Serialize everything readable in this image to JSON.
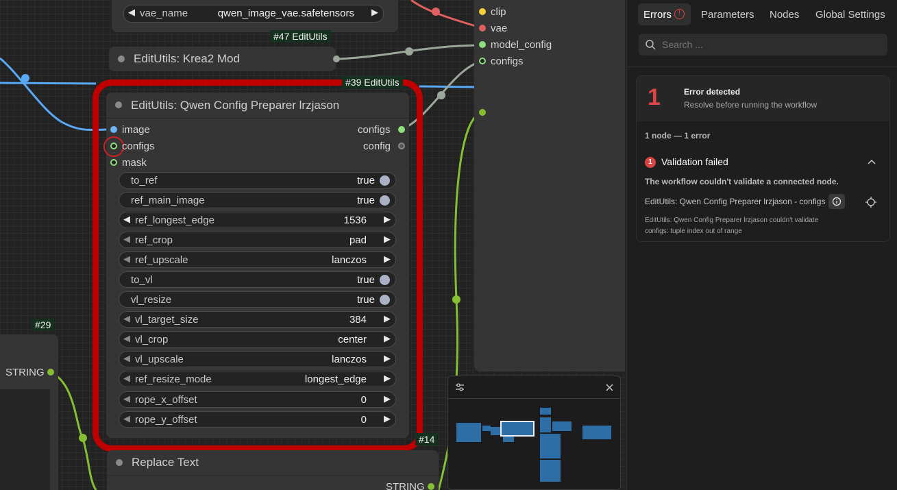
{
  "canvas": {
    "vae_loader": {
      "widget_label": "vae_name",
      "widget_value": "qwen_image_vae.safetensors"
    },
    "node_krea": {
      "badge": "#47 EditUtils",
      "title": "EditUtils: Krea2 Mod"
    },
    "loader_node": {
      "outputs": [
        "clip",
        "vae",
        "model_config",
        "configs"
      ]
    },
    "main_node": {
      "badge": "#39 EditUtils",
      "title": "EditUtils: Qwen Config Preparer lrzjason",
      "inputs": [
        "image",
        "configs",
        "mask"
      ],
      "outputs": [
        "configs",
        "config"
      ],
      "widgets": [
        {
          "label": "to_ref",
          "value": "true",
          "kind": "toggle"
        },
        {
          "label": "ref_main_image",
          "value": "true",
          "kind": "toggle"
        },
        {
          "label": "ref_longest_edge",
          "value": "1536",
          "kind": "number"
        },
        {
          "label": "ref_crop",
          "value": "pad",
          "kind": "combo"
        },
        {
          "label": "ref_upscale",
          "value": "lanczos",
          "kind": "combo"
        },
        {
          "label": "to_vl",
          "value": "true",
          "kind": "toggle"
        },
        {
          "label": "vl_resize",
          "value": "true",
          "kind": "toggle"
        },
        {
          "label": "vl_target_size",
          "value": "384",
          "kind": "number"
        },
        {
          "label": "vl_crop",
          "value": "center",
          "kind": "combo"
        },
        {
          "label": "vl_upscale",
          "value": "lanczos",
          "kind": "combo"
        },
        {
          "label": "ref_resize_mode",
          "value": "longest_edge",
          "kind": "combo"
        },
        {
          "label": "rope_x_offset",
          "value": "0",
          "kind": "number"
        },
        {
          "label": "rope_y_offset",
          "value": "0",
          "kind": "number"
        }
      ]
    },
    "node_29": {
      "badge": "#29",
      "output": "STRING"
    },
    "node_14": {
      "badge": "#14",
      "title": "Replace Text",
      "output": "STRING"
    }
  },
  "panel": {
    "tabs": [
      "Errors",
      "Parameters",
      "Nodes",
      "Global Settings"
    ],
    "active_tab": "Errors",
    "search_placeholder": "Search ...",
    "summary": {
      "count": "1",
      "title": "Error detected",
      "subtitle": "Resolve before running the workflow"
    },
    "group_label": "1 node — 1 error",
    "error": {
      "badge": "1",
      "title": "Validation failed",
      "description": "The workflow couldn't validate a connected node.",
      "node_ref": "EditUtils: Qwen Config Preparer lrzjason - configs",
      "detail": "EditUtils: Qwen Config Preparer lrzjason couldn't validate configs: tuple index out of range"
    }
  },
  "colors": {
    "error_highlight": "#c00000",
    "link_blue": "#5aa9f4",
    "link_green": "#86bf32",
    "link_grey": "#9aa79a",
    "link_red": "#e0605f",
    "error_red": "#e04444"
  }
}
